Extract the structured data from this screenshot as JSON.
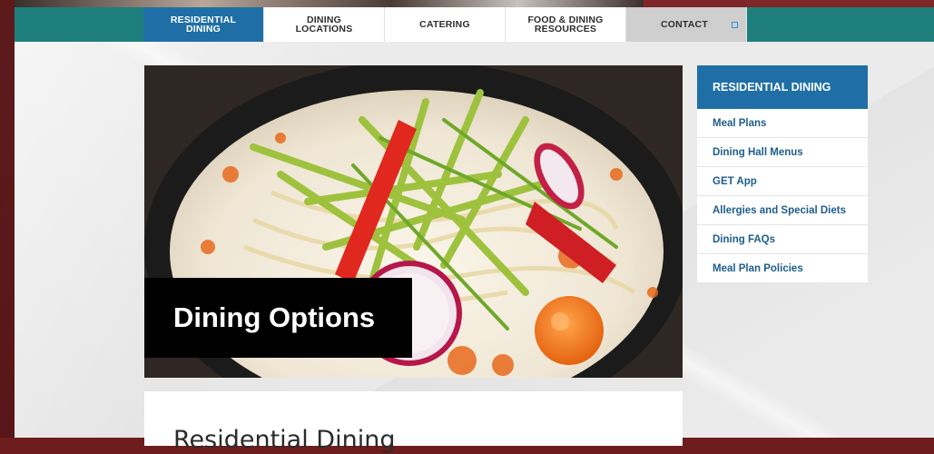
{
  "nav": {
    "items": [
      {
        "label": "RESIDENTIAL\nDINING",
        "active": true
      },
      {
        "label": "DINING\nLOCATIONS",
        "active": false
      },
      {
        "label": "CATERING",
        "active": false
      },
      {
        "label": "FOOD & DINING\nRESOURCES",
        "active": false
      },
      {
        "label": "CONTACT",
        "active": false
      }
    ]
  },
  "hero": {
    "caption": "Dining Options"
  },
  "sidebar": {
    "header": "RESIDENTIAL DINING",
    "links": [
      {
        "label": "Meal Plans"
      },
      {
        "label": "Dining Hall Menus"
      },
      {
        "label": "GET App"
      },
      {
        "label": "Allergies and Special Diets"
      },
      {
        "label": "Dining FAQs"
      },
      {
        "label": "Meal Plan Policies"
      }
    ]
  },
  "main": {
    "section_title": "Residential Dining"
  },
  "colors": {
    "nav_bar": "#1e7f7c",
    "active_nav": "#1f6fa6",
    "link": "#1d5d8c",
    "side_background": "#6e1d1f"
  }
}
